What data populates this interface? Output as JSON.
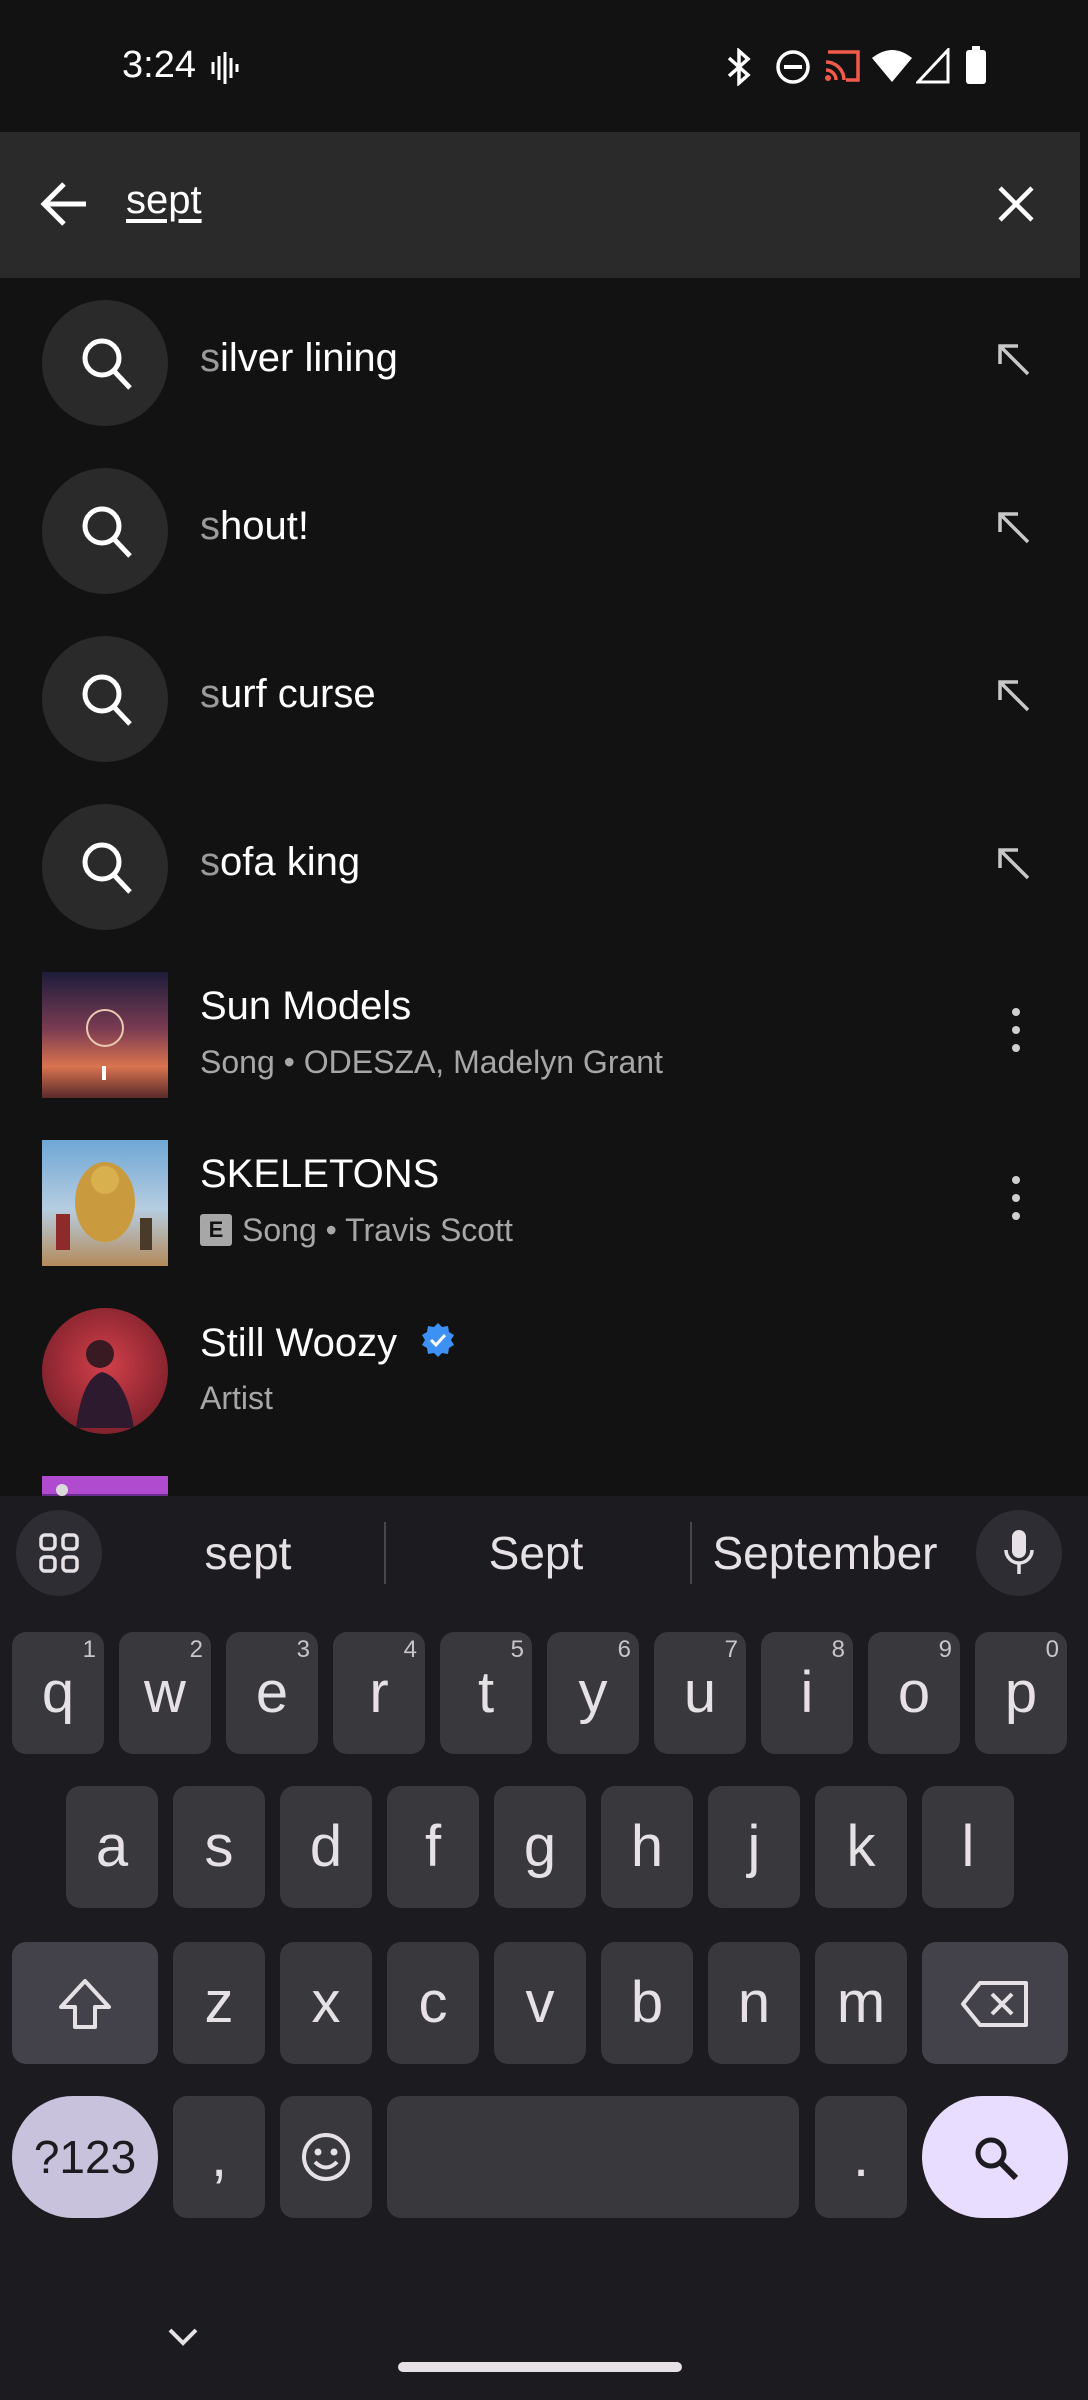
{
  "status_bar": {
    "time": "3:24"
  },
  "search": {
    "query": "sept"
  },
  "suggestions": [
    {
      "first": "s",
      "rest": "ilver lining"
    },
    {
      "first": "s",
      "rest": "hout!"
    },
    {
      "first": "s",
      "rest": "urf curse"
    },
    {
      "first": "s",
      "rest": "ofa king"
    }
  ],
  "results": [
    {
      "title": "Sun Models",
      "subtitle": "Song • ODESZA, Madelyn Grant"
    },
    {
      "title": "SKELETONS",
      "explicit": "E",
      "subtitle": "Song • Travis Scott"
    },
    {
      "title": "Still Woozy",
      "subtitle": "Artist"
    }
  ],
  "keyboard": {
    "suggestions": [
      "sept",
      "Sept",
      "September"
    ],
    "row1": [
      {
        "k": "q",
        "n": "1"
      },
      {
        "k": "w",
        "n": "2"
      },
      {
        "k": "e",
        "n": "3"
      },
      {
        "k": "r",
        "n": "4"
      },
      {
        "k": "t",
        "n": "5"
      },
      {
        "k": "y",
        "n": "6"
      },
      {
        "k": "u",
        "n": "7"
      },
      {
        "k": "i",
        "n": "8"
      },
      {
        "k": "o",
        "n": "9"
      },
      {
        "k": "p",
        "n": "0"
      }
    ],
    "row2": [
      "a",
      "s",
      "d",
      "f",
      "g",
      "h",
      "j",
      "k",
      "l"
    ],
    "row3": [
      "z",
      "x",
      "c",
      "v",
      "b",
      "n",
      "m"
    ],
    "symbols_label": "?123",
    "comma": ",",
    "period": "."
  },
  "colors": {
    "verified": "#3d91f4",
    "accent_key": "#e8ddff",
    "symbols_key": "#c9c2dc"
  }
}
